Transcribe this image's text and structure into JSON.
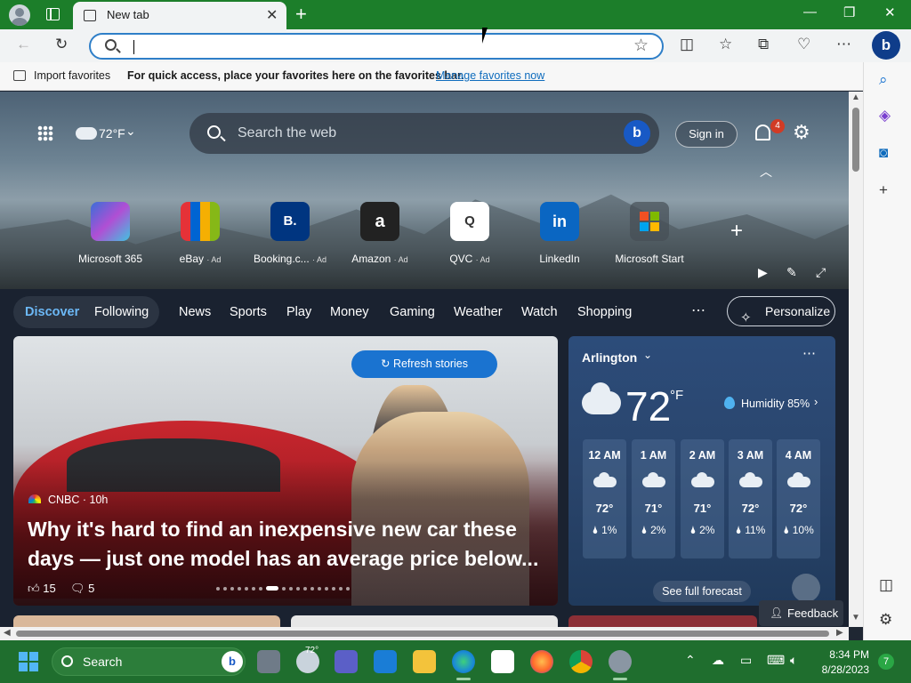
{
  "browser": {
    "tab_title": "New tab",
    "address_placeholder": "",
    "colors": {
      "titlebar": "#1c7e2a",
      "accent": "#2f7fc8",
      "taskbar": "#1f6e2e"
    }
  },
  "favorites_bar": {
    "import_label": "Import favorites",
    "hint": "For quick access, place your favorites here on the favorites bar.",
    "manage_link": "Manage favorites now"
  },
  "hero": {
    "weather_temp": "72°F",
    "search_placeholder": "Search the web",
    "sign_in": "Sign in",
    "notification_count": "4",
    "shortcuts": [
      {
        "label": "Microsoft 365",
        "ad": "",
        "icon": "m365-icon"
      },
      {
        "label": "eBay",
        "ad": "· Ad",
        "icon": "ebay-icon"
      },
      {
        "label": "Booking.c...",
        "ad": "· Ad",
        "icon": "booking-icon",
        "glyph": "B."
      },
      {
        "label": "Amazon",
        "ad": "· Ad",
        "icon": "amazon-icon",
        "glyph": "a"
      },
      {
        "label": "QVC",
        "ad": "· Ad",
        "icon": "qvc-icon",
        "glyph": "Q"
      },
      {
        "label": "LinkedIn",
        "ad": "",
        "icon": "linkedin-icon",
        "glyph": "in"
      },
      {
        "label": "Microsoft Start",
        "ad": "",
        "icon": "microsoft-start-icon"
      }
    ]
  },
  "nav": {
    "items": [
      "Discover",
      "Following",
      "News",
      "Sports",
      "Play",
      "Money",
      "Gaming",
      "Weather",
      "Watch",
      "Shopping"
    ],
    "personalize": "Personalize"
  },
  "story": {
    "refresh": "Refresh stories",
    "source": "CNBC · 10h",
    "headline": "Why it's hard to find an inexpensive new car these days — just one model has an average price below...",
    "likes": "15",
    "comments": "5"
  },
  "weather": {
    "city": "Arlington",
    "temp": "72",
    "unit": "°F",
    "humidity": "Humidity 85%",
    "hours": [
      {
        "time": "12 AM",
        "temp": "72°",
        "precip": "1%",
        "icon": "cloud-icon"
      },
      {
        "time": "1 AM",
        "temp": "71°",
        "precip": "2%",
        "icon": "cloud-icon"
      },
      {
        "time": "2 AM",
        "temp": "71°",
        "precip": "2%",
        "icon": "cloud-icon"
      },
      {
        "time": "3 AM",
        "temp": "72°",
        "precip": "11%",
        "icon": "partly-cloudy-icon"
      },
      {
        "time": "4 AM",
        "temp": "72°",
        "precip": "10%",
        "icon": "cloud-icon"
      }
    ],
    "forecast_button": "See full forecast"
  },
  "feedback": "Feedback",
  "taskbar": {
    "search_label": "Search",
    "weather_temp": "72°",
    "time": "8:34 PM",
    "date": "8/28/2023",
    "notification_count": "7"
  }
}
